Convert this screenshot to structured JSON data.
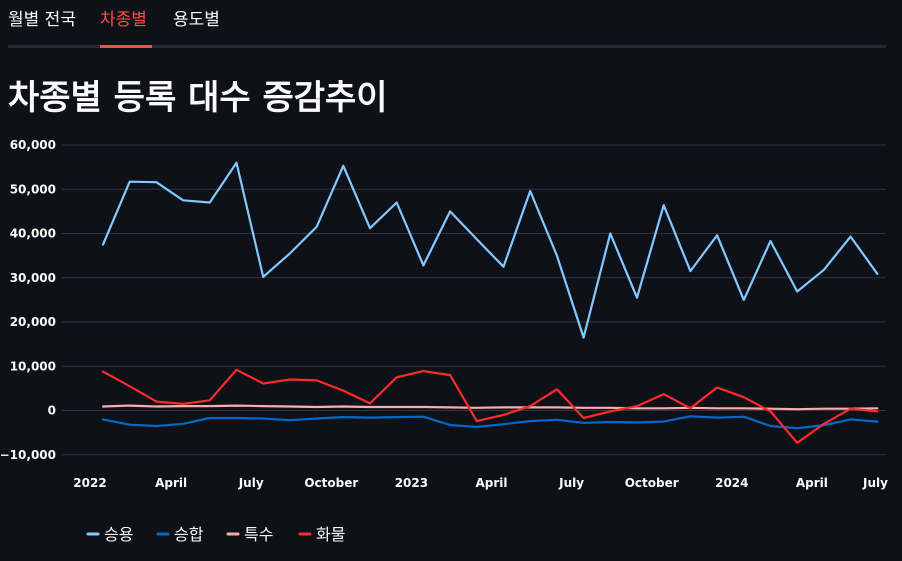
{
  "tabs": [
    {
      "label": "월별 전국",
      "active": false
    },
    {
      "label": "차종별",
      "active": true
    },
    {
      "label": "용도별",
      "active": false
    }
  ],
  "page_title": "차종별 등록 대수 증감추이",
  "colors": {
    "background": "#0e1117",
    "text": "#fafafa",
    "accent": "#ff4b4b",
    "grid": "#31333f"
  },
  "chart_data": {
    "type": "line",
    "title": "",
    "xlabel": "",
    "ylabel": "",
    "x": [
      "2022-01",
      "2022-02",
      "2022-03",
      "2022-04",
      "2022-05",
      "2022-06",
      "2022-07",
      "2022-08",
      "2022-09",
      "2022-10",
      "2022-11",
      "2022-12",
      "2023-01",
      "2023-02",
      "2023-03",
      "2023-04",
      "2023-05",
      "2023-06",
      "2023-07",
      "2023-08",
      "2023-09",
      "2023-10",
      "2023-11",
      "2023-12",
      "2024-01",
      "2024-02",
      "2024-03",
      "2024-04",
      "2024-05",
      "2024-06",
      "2024-07"
    ],
    "x_ticks": [
      "2022",
      "April",
      "July",
      "October",
      "2023",
      "April",
      "July",
      "October",
      "2024",
      "April",
      "July"
    ],
    "y_ticks": [
      "60,000",
      "50,000",
      "40,000",
      "30,000",
      "20,000",
      "10,000",
      "0",
      "−10,000"
    ],
    "ylim": [
      -11000,
      62000
    ],
    "grid": true,
    "legend_position": "bottom-left",
    "series": [
      {
        "name": "승용",
        "color": "#83c9ff",
        "values": [
          37500,
          51700,
          51600,
          47500,
          47000,
          56000,
          30200,
          35500,
          41500,
          55300,
          41200,
          47000,
          32800,
          45000,
          38700,
          32500,
          49600,
          35000,
          16500,
          40000,
          25500,
          46400,
          31500,
          39600,
          25000,
          38300,
          26900,
          31800,
          39300,
          30900
        ]
      },
      {
        "name": "승합",
        "color": "#0068c9",
        "values": [
          -2000,
          -3200,
          -3500,
          -3000,
          -1700,
          -1700,
          -1800,
          -2200,
          -1800,
          -1500,
          -1600,
          -1500,
          -1400,
          -3300,
          -3700,
          -3100,
          -2400,
          -2100,
          -2800,
          -2600,
          -2700,
          -2500,
          -1300,
          -1600,
          -1400,
          -3500,
          -4000,
          -3300,
          -2000,
          -2500
        ]
      },
      {
        "name": "특수",
        "color": "#ffabab",
        "values": [
          900,
          1100,
          900,
          1000,
          1000,
          1100,
          1000,
          900,
          800,
          900,
          800,
          800,
          800,
          700,
          600,
          700,
          700,
          700,
          600,
          600,
          500,
          500,
          600,
          500,
          500,
          400,
          300,
          400,
          400,
          500
        ]
      },
      {
        "name": "화물",
        "color": "#ff2b2b",
        "values": [
          8800,
          5500,
          2000,
          1500,
          2300,
          9200,
          6100,
          7000,
          6800,
          4500,
          1600,
          7500,
          8900,
          8000,
          -2400,
          -1000,
          1000,
          4800,
          -1700,
          -200,
          1000,
          3700,
          500,
          5200,
          3000,
          -200,
          -7300,
          -3000,
          400,
          -200
        ]
      }
    ]
  }
}
